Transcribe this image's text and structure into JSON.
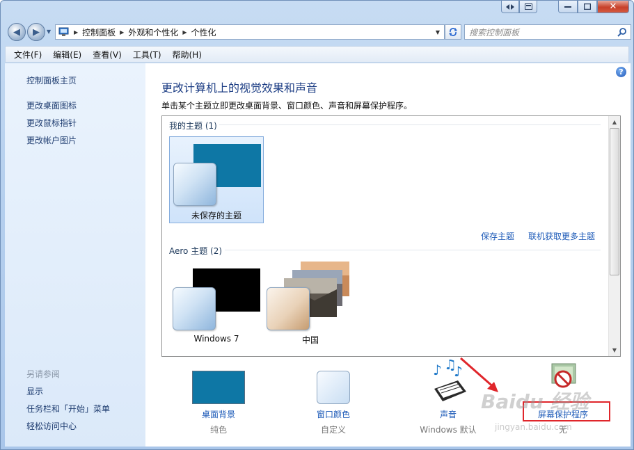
{
  "window": {
    "caption_buttons": [
      "minimize",
      "maximize",
      "close"
    ]
  },
  "address": {
    "crumbs": [
      "控制面板",
      "外观和个性化",
      "个性化"
    ],
    "search_placeholder": "搜索控制面板"
  },
  "menu": [
    "文件(F)",
    "编辑(E)",
    "查看(V)",
    "工具(T)",
    "帮助(H)"
  ],
  "leftnav": {
    "home": "控制面板主页",
    "links": [
      "更改桌面图标",
      "更改鼠标指针",
      "更改帐户图片"
    ],
    "see_also_title": "另请参阅",
    "see_also": [
      "显示",
      "任务栏和「开始」菜单",
      "轻松访问中心"
    ]
  },
  "main": {
    "title": "更改计算机上的视觉效果和声音",
    "subtitle": "单击某个主题立即更改桌面背景、窗口颜色、声音和屏幕保护程序。",
    "my_themes_label": "我的主题 (1)",
    "unsaved_theme": "未保存的主题",
    "save_theme": "保存主题",
    "get_more": "联机获取更多主题",
    "aero_label": "Aero 主题 (2)",
    "aero_themes": [
      "Windows 7",
      "中国"
    ]
  },
  "tiles": [
    {
      "label": "桌面背景",
      "sub": "纯色"
    },
    {
      "label": "窗口颜色",
      "sub": "自定义"
    },
    {
      "label": "声音",
      "sub": "Windows 默认"
    },
    {
      "label": "屏幕保护程序",
      "sub": "无"
    }
  ],
  "watermark": {
    "main": "Baidu 经验",
    "sub": "jingyan.baidu.com"
  },
  "colors": {
    "accent_link": "#1a58b7",
    "title": "#1c3d84",
    "annotation": "#e0262b",
    "desktop_bg": "#0e77a5"
  }
}
